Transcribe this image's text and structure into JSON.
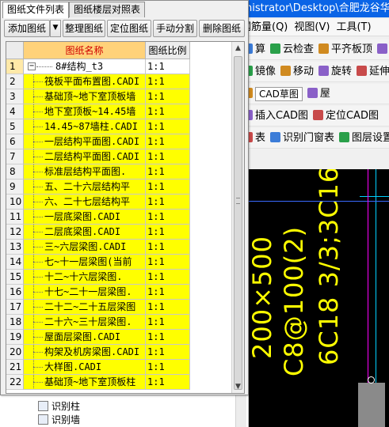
{
  "colors": {
    "row_highlight": "#ffff00",
    "header_bg": "#ffd27a",
    "header_text": "#d00000",
    "titlebar": "#0a64e6",
    "cad_text": "#ffff00",
    "cad_bg": "#000000"
  },
  "app": {
    "title": "nistrator\\Desktop\\合肥龙谷华庭",
    "menu": [
      "钢筋量(Q)",
      "视图(V)",
      "工具(T)"
    ],
    "toolbar_rows": [
      {
        "items": [
          {
            "icon": "compute-icon",
            "label": "算"
          },
          {
            "icon": "cloud-check-icon",
            "label": "云检查"
          },
          {
            "icon": "flat-slab-icon",
            "label": "平齐板顶"
          },
          {
            "icon": "find-icon",
            "label": "查"
          }
        ]
      },
      {
        "items": [
          {
            "icon": "mirror-icon",
            "label": "镜像"
          },
          {
            "icon": "move-icon",
            "label": "移动"
          },
          {
            "icon": "rotate-icon",
            "label": "旋转"
          },
          {
            "icon": "extend-icon",
            "label": "延伸"
          }
        ]
      },
      {
        "items": [
          {
            "icon": "cad-sketch-icon",
            "label": "CAD草图",
            "combo": true
          },
          {
            "icon": "layer-icon",
            "label": "屋"
          }
        ]
      },
      {
        "items": [
          {
            "icon": "insert-cad-icon",
            "label": "插入CAD图"
          },
          {
            "icon": "locate-cad-icon",
            "label": "定位CAD图"
          }
        ]
      },
      {
        "items": [
          {
            "icon": "table-icon",
            "label": "表"
          },
          {
            "icon": "door-window-icon",
            "label": "识别门窗表"
          },
          {
            "icon": "layer-display-icon",
            "label": "图层设置"
          }
        ]
      }
    ],
    "cad_texts": [
      "200×500",
      "C8@100(2)",
      "6C18 3/3;3C16"
    ],
    "tree_items": [
      "识别柱",
      "识别墙"
    ]
  },
  "panel": {
    "tabs": [
      "图纸文件列表",
      "图纸楼层对照表"
    ],
    "active_tab": 0,
    "toolbar": {
      "add": "添加图纸",
      "organize": "整理图纸",
      "locate": "定位图纸",
      "manual_split": "手动分割",
      "delete": "删除图纸"
    },
    "columns": [
      "图纸名称",
      "图纸比例"
    ],
    "rows": [
      {
        "num": "1",
        "name": "8#结构_t3",
        "scale": "1:1"
      },
      {
        "num": "2",
        "name": "筏板平面布置图.CADI",
        "scale": "1:1"
      },
      {
        "num": "3",
        "name": "基础顶~地下室顶板墙",
        "scale": "1:1"
      },
      {
        "num": "4",
        "name": "地下室顶板~14.45墙",
        "scale": "1:1"
      },
      {
        "num": "5",
        "name": "14.45~87墙柱.CADI",
        "scale": "1:1"
      },
      {
        "num": "6",
        "name": "一层结构平面图.CADI",
        "scale": "1:1"
      },
      {
        "num": "7",
        "name": "二层结构平面图.CADI",
        "scale": "1:1"
      },
      {
        "num": "8",
        "name": "标准层结构平面图.",
        "scale": "1:1"
      },
      {
        "num": "9",
        "name": "五、二十六层结构平",
        "scale": "1:1"
      },
      {
        "num": "10",
        "name": "六、二十七层结构平",
        "scale": "1:1"
      },
      {
        "num": "11",
        "name": "一层底梁图.CADI",
        "scale": "1:1"
      },
      {
        "num": "12",
        "name": "二层底梁图.CADI",
        "scale": "1:1"
      },
      {
        "num": "13",
        "name": "三~六层梁图.CADI",
        "scale": "1:1"
      },
      {
        "num": "14",
        "name": "七~十一层梁图(当前",
        "scale": "1:1"
      },
      {
        "num": "15",
        "name": "十二~十六层梁图.",
        "scale": "1:1"
      },
      {
        "num": "16",
        "name": "十七~二十一层梁图.",
        "scale": "1:1"
      },
      {
        "num": "17",
        "name": "二十二~二十五层梁图",
        "scale": "1:1"
      },
      {
        "num": "18",
        "name": "二十六~三十层梁图.",
        "scale": "1:1"
      },
      {
        "num": "19",
        "name": "屋面层梁图.CADI",
        "scale": "1:1"
      },
      {
        "num": "20",
        "name": "构架及机房梁图.CADI",
        "scale": "1:1"
      },
      {
        "num": "21",
        "name": "大样图.CADI",
        "scale": "1:1"
      },
      {
        "num": "22",
        "name": "基础顶~地下室顶板柱",
        "scale": "1:1"
      }
    ]
  }
}
